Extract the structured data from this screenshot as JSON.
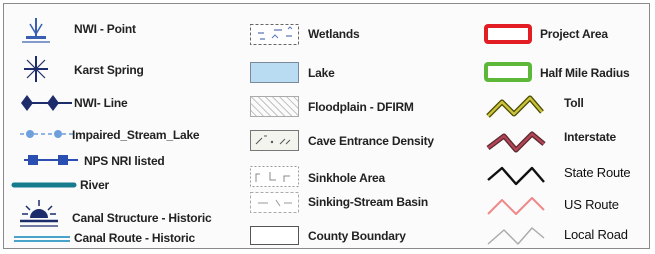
{
  "legend": {
    "col1": [
      {
        "label": "NWI - Point",
        "symbol": "nwi-point-icon"
      },
      {
        "label": "Karst Spring",
        "symbol": "karst-spring-icon"
      },
      {
        "label": "NWI- Line",
        "symbol": "nwi-line-symbol"
      },
      {
        "label": "Impaired_Stream_Lake",
        "symbol": "impaired-stream-lake-symbol"
      },
      {
        "label": "NPS NRI listed",
        "symbol": "nps-nri-symbol"
      },
      {
        "label": "River",
        "symbol": "river-line-symbol"
      },
      {
        "label": "Canal Structure - Historic",
        "symbol": "canal-structure-icon"
      },
      {
        "label": "Canal Route - Historic",
        "symbol": "canal-route-symbol"
      }
    ],
    "col2": [
      {
        "label": "Wetlands",
        "symbol": "wetlands-swatch"
      },
      {
        "label": "Lake",
        "symbol": "lake-swatch"
      },
      {
        "label": "Floodplain - DFIRM",
        "symbol": "floodplain-swatch"
      },
      {
        "label": "Cave Entrance Density",
        "symbol": "cave-density-swatch"
      },
      {
        "label": "Sinkhole Area",
        "symbol": "sinkhole-swatch"
      },
      {
        "label": "Sinking-Stream Basin",
        "symbol": "sinking-stream-swatch"
      },
      {
        "label": "County Boundary",
        "symbol": "county-boundary-swatch"
      }
    ],
    "col3": [
      {
        "label": "Project Area",
        "symbol": "project-area-swatch"
      },
      {
        "label": "Half Mile Radius",
        "symbol": "half-mile-radius-swatch"
      },
      {
        "label": "Toll",
        "symbol": "toll-road-symbol"
      },
      {
        "label": "Interstate",
        "symbol": "interstate-symbol"
      },
      {
        "label": "State Route",
        "symbol": "state-route-symbol"
      },
      {
        "label": "US Route",
        "symbol": "us-route-symbol"
      },
      {
        "label": "Local Road",
        "symbol": "local-road-symbol"
      }
    ],
    "colors": {
      "nwi_blue": "#3b5fb0",
      "karst_navy": "#1d2c6b",
      "impaired_blue": "#6f9fdc",
      "nps_blue": "#2b4fb0",
      "river_teal": "#167b8c",
      "canal_blue": "#4aa3c8",
      "lake_fill": "#b9dcf2",
      "project_red": "#e31d24",
      "radius_green": "#5db83a",
      "toll_outer": "#4a4a00",
      "toll_inner": "#c9c23c",
      "interstate_outer": "#5a2a30",
      "interstate_inner": "#b34455",
      "state_route": "#111111",
      "us_route": "#f0888a",
      "local_road": "#a9a9a9"
    }
  }
}
